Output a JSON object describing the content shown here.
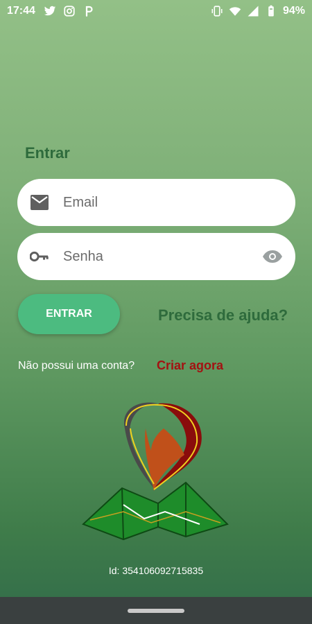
{
  "status_bar": {
    "time": "17:44",
    "left_icons": [
      "twitter-icon",
      "instagram-icon",
      "pinterest-icon"
    ],
    "right_icons": [
      "vibrate-icon",
      "wifi-icon",
      "signal-icon",
      "battery-icon"
    ],
    "battery": "94%"
  },
  "login": {
    "title": "Entrar",
    "email_placeholder": "Email",
    "password_placeholder": "Senha",
    "submit_label": "ENTRAR",
    "help_link": "Precisa de ajuda?"
  },
  "signup": {
    "prompt": "Não possui uma conta?",
    "link": "Criar agora"
  },
  "footer": {
    "device_id": "Id: 354106092715835"
  },
  "colors": {
    "accent_green": "#4cbb80",
    "title_green": "#2e6b3c",
    "link_red": "#a31212",
    "nav_bar": "#3a4040"
  }
}
